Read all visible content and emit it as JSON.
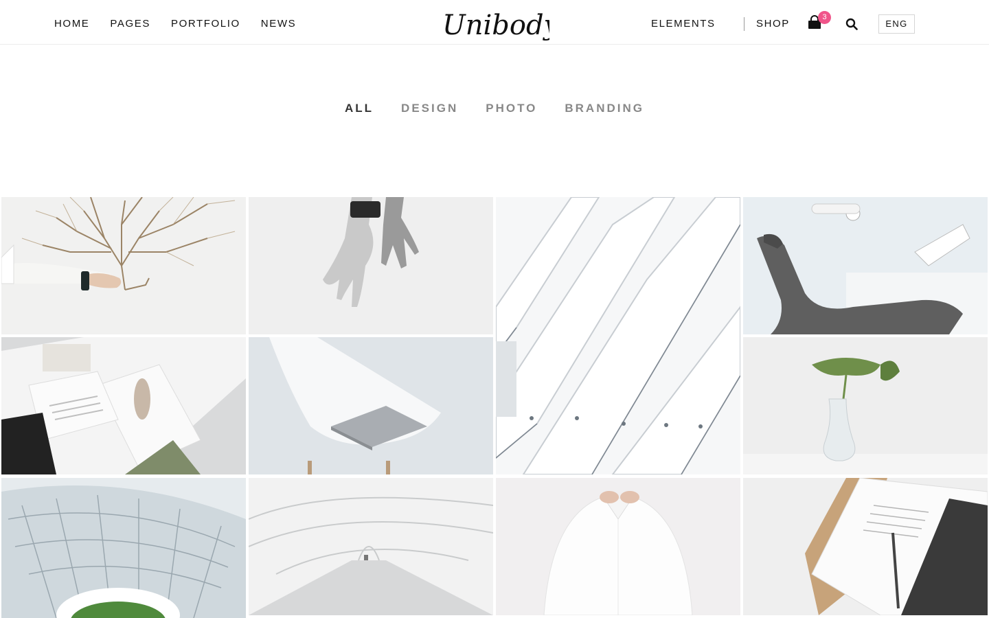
{
  "header": {
    "nav_left": [
      "HOME",
      "PAGES",
      "PORTFOLIO",
      "NEWS"
    ],
    "logo_text": "Unibody",
    "nav_right": {
      "elements": "ELEMENTS",
      "shop": "SHOP"
    },
    "cart_count": "3",
    "language": "ENG"
  },
  "filters": {
    "items": [
      "ALL",
      "DESIGN",
      "PHOTO",
      "BRANDING"
    ],
    "active": "ALL"
  },
  "colors": {
    "badge": "#f0558a",
    "active_filter": "#333333",
    "inactive_filter": "#888888"
  },
  "portfolio": {
    "items": [
      {
        "subject": "hand holding dry tree branch"
      },
      {
        "subject": "hands with smartwatch"
      },
      {
        "subject": "white architectural ribs"
      },
      {
        "subject": "dental chair"
      },
      {
        "subject": "magazine spreads"
      },
      {
        "subject": "laptop on white chair"
      },
      {
        "subject": "monstera leaf in vase"
      },
      {
        "subject": "spiral staircase"
      },
      {
        "subject": "white arched corridor"
      },
      {
        "subject": "man buttoning white shirt"
      },
      {
        "subject": "open book with pen"
      }
    ]
  }
}
